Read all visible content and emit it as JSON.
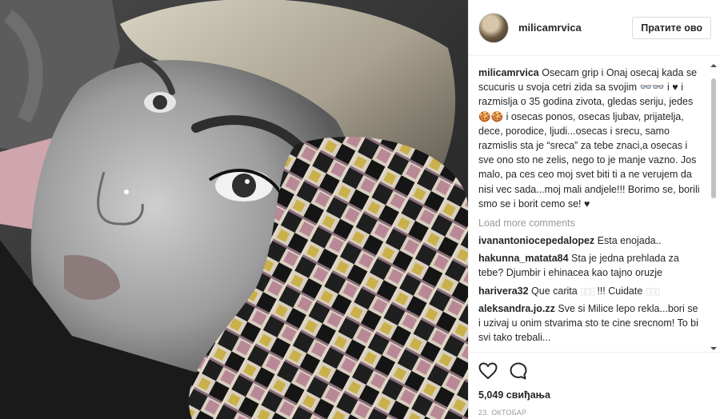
{
  "post": {
    "username": "milicamrvica",
    "follow_label": "Пратите ово",
    "caption": {
      "username": "milicamrvica",
      "text": "Osecam grip i Onaj osecaj kada se scucuris u svoja cetri zida sa svojim 👓👓 i ♥ i razmislja o 35 godina zivota, gledas seriju, jedes 🍪🍪 i osecas ponos, osecas ljubav, prijatelja, dece, porodice, ljudi...osecas i srecu, samo razmislis sta je “sreca” za tebe znaci,a osecas i sve ono sto ne zelis, nego to je manje vazno. Jos malo, pa ces ceo moj svet biti ti a ne verujem da nisi vec sada...moj mali andjele!!! Borimo se, borili smo se i borit cemo se! ♥"
    },
    "load_more": "Load more comments",
    "comments": [
      {
        "username": "ivanantoniocepedalopez",
        "text": "Esta enojada.."
      },
      {
        "username": "hakunna_matata84",
        "text": "Sta je jedna prehlada za tebe? Djumbir i ehinacea kao tajno oruzje"
      },
      {
        "username": "harivera32",
        "text": "Que carita",
        "trail": "!!! Cuidate"
      },
      {
        "username": "aleksandra.jo.zz",
        "text": "Sve si Milice lepo rekla...bori se i uzivaj u onim stvarima sto te cine srecnom! To bi svi tako trebali..."
      }
    ],
    "likes": "5,049 свиђања",
    "date": "23. октобар"
  },
  "icons": {
    "like": "heart-icon",
    "comment": "comment-icon",
    "avatar": "avatar",
    "scroll_up": "scroll-up-arrow",
    "scroll_down": "scroll-down-arrow"
  },
  "colors": {
    "text": "#262626",
    "muted": "#999999",
    "border": "#dbdbdb",
    "scrollbar": "#c1c1c1"
  }
}
